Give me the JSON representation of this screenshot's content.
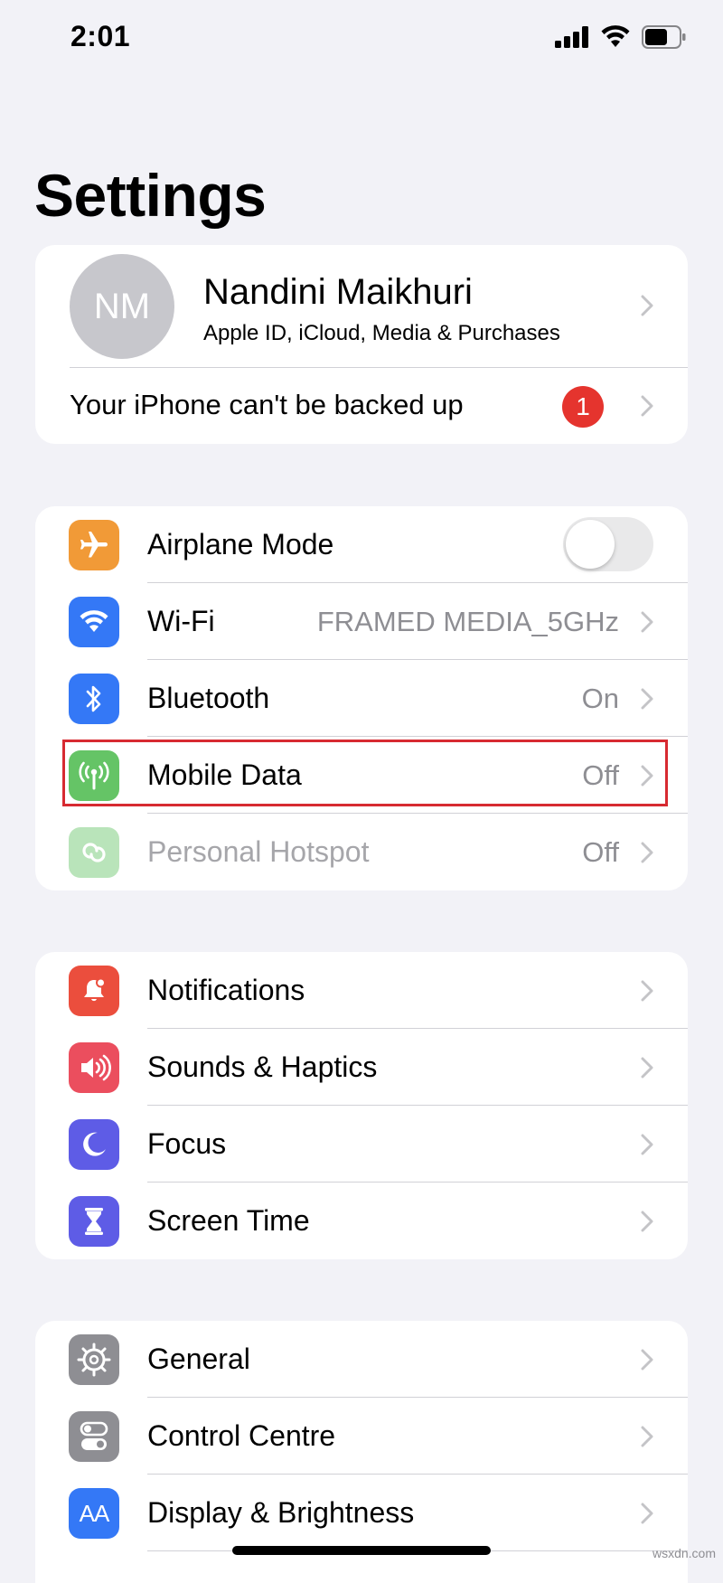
{
  "status_bar": {
    "time": "2:01"
  },
  "page_title": "Settings",
  "profile": {
    "initials": "NM",
    "name": "Nandini Maikhuri",
    "subtitle": "Apple ID, iCloud, Media & Purchases",
    "backup_message": "Your iPhone can't be backed up",
    "badge_count": "1"
  },
  "connectivity": [
    {
      "label": "Airplane Mode",
      "icon": "airplane-icon",
      "color": "#f19a37",
      "toggle_on": false
    },
    {
      "label": "Wi-Fi",
      "value": "FRAMED MEDIA_5GHz",
      "icon": "wifi-icon",
      "color": "#3478f6"
    },
    {
      "label": "Bluetooth",
      "value": "On",
      "icon": "bluetooth-icon",
      "color": "#3478f6"
    },
    {
      "label": "Mobile Data",
      "value": "Off",
      "icon": "antenna-icon",
      "color": "#65c466"
    },
    {
      "label": "Personal Hotspot",
      "value": "Off",
      "icon": "hotspot-link-icon",
      "color": "#65c466"
    }
  ],
  "notifications_group": [
    {
      "label": "Notifications",
      "icon": "bell-icon",
      "color": "#eb4e3d"
    },
    {
      "label": "Sounds & Haptics",
      "icon": "speaker-icon",
      "color": "#eb4e5e"
    },
    {
      "label": "Focus",
      "icon": "moon-icon",
      "color": "#5e5ce6"
    },
    {
      "label": "Screen Time",
      "icon": "hourglass-icon",
      "color": "#5e5ce6"
    }
  ],
  "general_group": [
    {
      "label": "General",
      "icon": "gear-icon",
      "color": "#8e8e93"
    },
    {
      "label": "Control Centre",
      "icon": "switches-icon",
      "color": "#8e8e93"
    },
    {
      "label": "Display & Brightness",
      "icon": "text-size-icon",
      "color": "#3478f6",
      "icon_text": "AA"
    }
  ],
  "watermark": "wsxdn.com",
  "accent_colors": {
    "highlight_box": "#d72a31",
    "badge": "#e5342e"
  }
}
